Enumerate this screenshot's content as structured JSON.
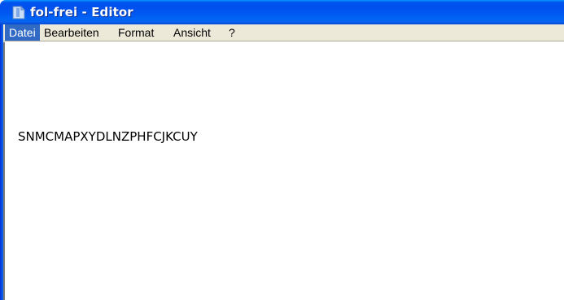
{
  "window": {
    "title": "fol-frei - Editor",
    "icon": "notepad-icon",
    "colors": {
      "titlebar": "#0054e3",
      "menubar": "#ece9d8",
      "menu_highlight": "#316ac5"
    }
  },
  "menu": {
    "items": [
      {
        "label": "Datei",
        "active": true
      },
      {
        "label": "Bearbeiten",
        "active": false
      },
      {
        "label": "Format",
        "active": false
      },
      {
        "label": "Ansicht",
        "active": false
      },
      {
        "label": "?",
        "active": false
      }
    ]
  },
  "editor": {
    "lines": [
      "",
      "SNMCMAPXYDLNZPHFCJKCUY"
    ]
  }
}
